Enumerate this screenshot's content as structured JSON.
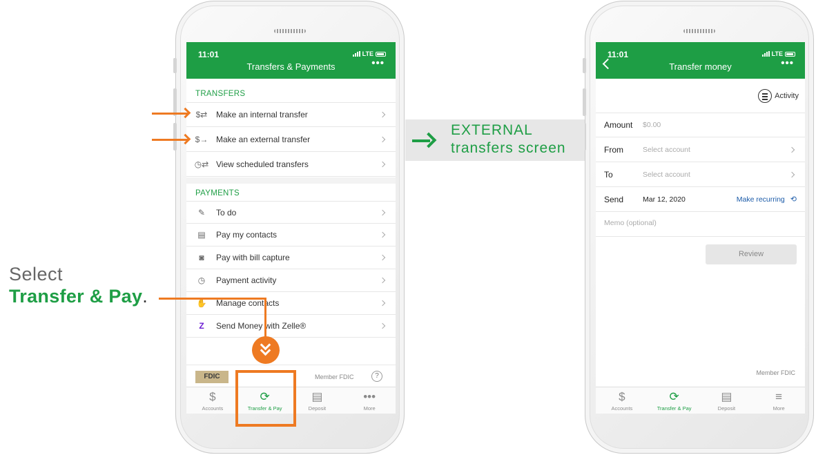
{
  "left_phone": {
    "status": {
      "time": "11:01",
      "network": "LTE"
    },
    "header": {
      "title": "Transfers & Payments",
      "more": "•••"
    },
    "transfers": {
      "section": "TRANSFERS",
      "items": [
        {
          "label": "Make an internal transfer"
        },
        {
          "label": "Make an external transfer"
        },
        {
          "label": "View scheduled transfers"
        }
      ]
    },
    "payments": {
      "section": "PAYMENTS",
      "items": [
        {
          "label": "To do"
        },
        {
          "label": "Pay my contacts"
        },
        {
          "label": "Pay with bill capture"
        },
        {
          "label": "Payment activity"
        },
        {
          "label": "Manage contacts"
        },
        {
          "label": "Send Money with Zelle®"
        }
      ]
    },
    "fdic": {
      "logo": "FDIC",
      "text": "Member FDIC",
      "help": "?"
    },
    "tabs": [
      {
        "label": "Accounts",
        "icon": "$"
      },
      {
        "label": "Transfer & Pay",
        "icon": "⟳"
      },
      {
        "label": "Deposit",
        "icon": "▤"
      },
      {
        "label": "More",
        "icon": "•••"
      }
    ]
  },
  "right_phone": {
    "status": {
      "time": "11:01",
      "network": "LTE"
    },
    "header": {
      "title": "Transfer money",
      "more": "•••"
    },
    "activity": "Activity",
    "form": {
      "amount_label": "Amount",
      "amount_placeholder": "$0.00",
      "from_label": "From",
      "from_placeholder": "Select account",
      "to_label": "To",
      "to_placeholder": "Select account",
      "send_label": "Send",
      "send_date": "Mar 12, 2020",
      "recurring": "Make recurring",
      "memo_placeholder": "Memo (optional)",
      "review": "Review"
    },
    "fdic_text": "Member FDIC",
    "tabs": [
      {
        "label": "Accounts",
        "icon": "$"
      },
      {
        "label": "Transfer & Pay",
        "icon": "⟳"
      },
      {
        "label": "Deposit",
        "icon": "▤"
      },
      {
        "label": "More",
        "icon": "≡"
      }
    ]
  },
  "annotations": {
    "select": "Select",
    "select_strong": "Transfer & Pay",
    "select_dot": ".",
    "external_line1": "EXTERNAL",
    "external_line2": "transfers screen"
  },
  "colors": {
    "brand_green": "#1e9e45",
    "annotation_orange": "#ee7a22",
    "link_blue": "#1a5aa8"
  }
}
